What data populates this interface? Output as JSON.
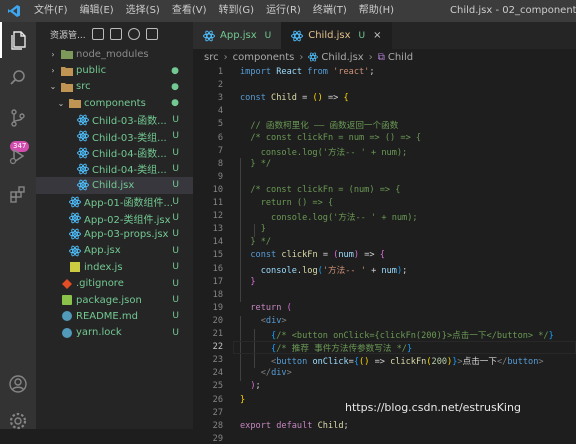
{
  "titlebar": {
    "menu": [
      "文件(F)",
      "编辑(E)",
      "选择(S)",
      "查看(V)",
      "转到(G)",
      "运行(R)",
      "终端(T)",
      "帮助(H)"
    ],
    "window_title": "Child.jsx - 02_component - Visu"
  },
  "activity": {
    "badge": "347"
  },
  "sidebar": {
    "header": "资源管...",
    "tree": [
      {
        "label": "node_modules",
        "chevron": "›",
        "icon": "folder",
        "color": "#8a8a8a",
        "status": "",
        "status_color": "",
        "indent": 0,
        "selected": false
      },
      {
        "label": "public",
        "chevron": "›",
        "icon": "folder",
        "color": "#73c991",
        "status": "●",
        "status_color": "#73c991",
        "indent": 0,
        "selected": false
      },
      {
        "label": "src",
        "chevron": "⌄",
        "icon": "folder",
        "color": "#73c991",
        "status": "●",
        "status_color": "#73c991",
        "indent": 0,
        "selected": false
      },
      {
        "label": "components",
        "chevron": "⌄",
        "icon": "folder",
        "color": "#73c991",
        "status": "●",
        "status_color": "#73c991",
        "indent": 1,
        "selected": false
      },
      {
        "label": "Child-03-函数...",
        "chevron": "",
        "icon": "react",
        "color": "#73c991",
        "status": "U",
        "status_color": "#73c991",
        "indent": 2,
        "selected": false
      },
      {
        "label": "Child-03-类组...",
        "chevron": "",
        "icon": "react",
        "color": "#73c991",
        "status": "U",
        "status_color": "#73c991",
        "indent": 2,
        "selected": false
      },
      {
        "label": "Child-04-函数...",
        "chevron": "",
        "icon": "react",
        "color": "#73c991",
        "status": "U",
        "status_color": "#73c991",
        "indent": 2,
        "selected": false
      },
      {
        "label": "Child-04-类组...",
        "chevron": "",
        "icon": "react",
        "color": "#73c991",
        "status": "U",
        "status_color": "#73c991",
        "indent": 2,
        "selected": false
      },
      {
        "label": "Child.jsx",
        "chevron": "",
        "icon": "react",
        "color": "#73c991",
        "status": "U",
        "status_color": "#73c991",
        "indent": 2,
        "selected": true
      },
      {
        "label": "App-01-函数组件...",
        "chevron": "",
        "icon": "react",
        "color": "#73c991",
        "status": "U",
        "status_color": "#73c991",
        "indent": 1,
        "selected": false
      },
      {
        "label": "App-02-类组件.jsx",
        "chevron": "",
        "icon": "react",
        "color": "#73c991",
        "status": "U",
        "status_color": "#73c991",
        "indent": 1,
        "selected": false
      },
      {
        "label": "App-03-props.jsx",
        "chevron": "",
        "icon": "react",
        "color": "#73c991",
        "status": "U",
        "status_color": "#73c991",
        "indent": 1,
        "selected": false
      },
      {
        "label": "App.jsx",
        "chevron": "",
        "icon": "react",
        "color": "#73c991",
        "status": "U",
        "status_color": "#73c991",
        "indent": 1,
        "selected": false
      },
      {
        "label": "index.js",
        "chevron": "",
        "icon": "js",
        "color": "#73c991",
        "status": "U",
        "status_color": "#73c991",
        "indent": 1,
        "selected": false
      },
      {
        "label": ".gitignore",
        "chevron": "",
        "icon": "git",
        "color": "#73c991",
        "status": "U",
        "status_color": "#73c991",
        "indent": 0,
        "selected": false
      },
      {
        "label": "package.json",
        "chevron": "",
        "icon": "json",
        "color": "#73c991",
        "status": "U",
        "status_color": "#73c991",
        "indent": 0,
        "selected": false
      },
      {
        "label": "README.md",
        "chevron": "",
        "icon": "info",
        "color": "#73c991",
        "status": "U",
        "status_color": "#73c991",
        "indent": 0,
        "selected": false
      },
      {
        "label": "yarn.lock",
        "chevron": "",
        "icon": "yarn",
        "color": "#73c991",
        "status": "U",
        "status_color": "#73c991",
        "indent": 0,
        "selected": false
      }
    ]
  },
  "tabs": [
    {
      "label": "App.jsx",
      "status": "U",
      "active": false
    },
    {
      "label": "Child.jsx",
      "status": "U",
      "active": true,
      "close": "×"
    }
  ],
  "breadcrumb": [
    "src",
    "components",
    "Child.jsx",
    "Child"
  ],
  "editor": {
    "current_line": 22,
    "lines": [
      {
        "n": "1",
        "t": [
          [
            "k",
            "import "
          ],
          [
            "v",
            "React "
          ],
          [
            "k",
            "from "
          ],
          [
            "s",
            "'react'"
          ],
          [
            "w",
            ";"
          ]
        ]
      },
      {
        "n": "2",
        "t": []
      },
      {
        "n": "3",
        "t": [
          [
            "k",
            "const "
          ],
          [
            "f",
            "Child "
          ],
          [
            "w",
            "= "
          ],
          [
            "by",
            "()"
          ],
          [
            "w",
            " => "
          ],
          [
            "by",
            "{"
          ]
        ]
      },
      {
        "n": "4",
        "t": []
      },
      {
        "n": "5",
        "t": [
          [
            "c",
            "  // 函数柯里化 —— 函数返回一个函数"
          ]
        ]
      },
      {
        "n": "6",
        "t": [
          [
            "c",
            "  /* const clickFn = num => () => {"
          ]
        ]
      },
      {
        "n": "7",
        "t": [
          [
            "c",
            "    console.log('方法-- ' + num);"
          ]
        ]
      },
      {
        "n": "8",
        "t": [
          [
            "c",
            "  } */"
          ]
        ]
      },
      {
        "n": "9",
        "t": []
      },
      {
        "n": "10",
        "t": [
          [
            "c",
            "  /* const clickFn = (num) => {"
          ]
        ]
      },
      {
        "n": "11",
        "t": [
          [
            "c",
            "    return () => {"
          ]
        ]
      },
      {
        "n": "12",
        "t": [
          [
            "c",
            "      console.log('方法-- ' + num);"
          ]
        ]
      },
      {
        "n": "13",
        "t": [
          [
            "c",
            "    }"
          ]
        ]
      },
      {
        "n": "14",
        "t": [
          [
            "c",
            "  } */"
          ]
        ]
      },
      {
        "n": "15",
        "t": [
          [
            "w",
            "  "
          ],
          [
            "k",
            "const "
          ],
          [
            "f",
            "clickFn "
          ],
          [
            "w",
            "= "
          ],
          [
            "bp",
            "("
          ],
          [
            "v",
            "num"
          ],
          [
            "bp",
            ")"
          ],
          [
            "w",
            " => "
          ],
          [
            "bp",
            "{"
          ]
        ]
      },
      {
        "n": "16",
        "t": [
          [
            "w",
            "    "
          ],
          [
            "v",
            "console"
          ],
          [
            "w",
            "."
          ],
          [
            "f",
            "log"
          ],
          [
            "bb",
            "("
          ],
          [
            "s",
            "'方法-- '"
          ],
          [
            "w",
            " + "
          ],
          [
            "v",
            "num"
          ],
          [
            "bb",
            ")"
          ],
          [
            "w",
            ";"
          ]
        ]
      },
      {
        "n": "17",
        "t": [
          [
            "w",
            "  "
          ],
          [
            "bp",
            "}"
          ]
        ]
      },
      {
        "n": "18",
        "t": []
      },
      {
        "n": "19",
        "t": [
          [
            "w",
            "  "
          ],
          [
            "kc",
            "return "
          ],
          [
            "bp",
            "("
          ]
        ]
      },
      {
        "n": "20",
        "t": [
          [
            "w",
            "    "
          ],
          [
            "tg",
            "<"
          ],
          [
            "t",
            "div"
          ],
          [
            "tg",
            ">"
          ]
        ]
      },
      {
        "n": "21",
        "t": [
          [
            "w",
            "      "
          ],
          [
            "bb",
            "{"
          ],
          [
            "c",
            "/* <button onClick={clickFn(200)}>点击一下</button> */"
          ],
          [
            "bb",
            "}"
          ]
        ]
      },
      {
        "n": "22",
        "t": [
          [
            "w",
            "      "
          ],
          [
            "bb",
            "{"
          ],
          [
            "c",
            "/* 推荐 事件方法传参数写法 */"
          ],
          [
            "bb",
            "}"
          ]
        ]
      },
      {
        "n": "23",
        "t": [
          [
            "w",
            "      "
          ],
          [
            "tg",
            "<"
          ],
          [
            "t",
            "button "
          ],
          [
            "a",
            "onClick"
          ],
          [
            "w",
            "="
          ],
          [
            "bb",
            "{"
          ],
          [
            "by",
            "()"
          ],
          [
            "w",
            " => "
          ],
          [
            "f",
            "clickFn"
          ],
          [
            "by",
            "("
          ],
          [
            "n",
            "200"
          ],
          [
            "by",
            ")"
          ],
          [
            "bb",
            "}"
          ],
          [
            "tg",
            ">"
          ],
          [
            "w",
            "点击一下"
          ],
          [
            "tg",
            "</"
          ],
          [
            "t",
            "button"
          ],
          [
            "tg",
            ">"
          ]
        ]
      },
      {
        "n": "24",
        "t": [
          [
            "w",
            "    "
          ],
          [
            "tg",
            "</"
          ],
          [
            "t",
            "div"
          ],
          [
            "tg",
            ">"
          ]
        ]
      },
      {
        "n": "25",
        "t": [
          [
            "w",
            "  "
          ],
          [
            "bp",
            ")"
          ],
          [
            "w",
            ";"
          ]
        ]
      },
      {
        "n": "26",
        "t": [
          [
            "by",
            "}"
          ]
        ]
      },
      {
        "n": "27",
        "t": []
      },
      {
        "n": "28",
        "t": [
          [
            "kc",
            "export "
          ],
          [
            "kc",
            "default "
          ],
          [
            "f",
            "Child"
          ],
          [
            "w",
            ";"
          ]
        ]
      },
      {
        "n": "29",
        "t": []
      }
    ]
  },
  "watermark": "https://blog.csdn.net/estrusKing"
}
